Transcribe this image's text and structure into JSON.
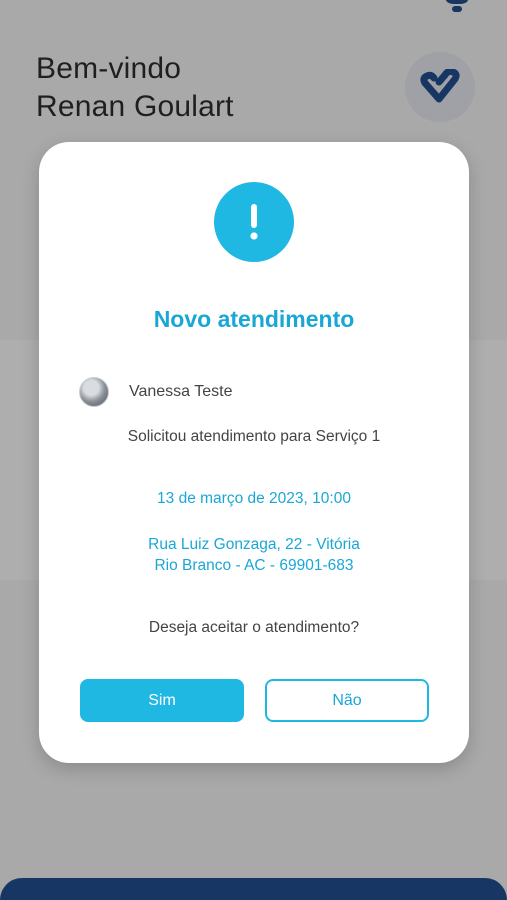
{
  "background": {
    "greeting_line1": "Bem-vindo",
    "greeting_line2": "Renan Goulart",
    "icons": [
      "bell-icon",
      "heart-logo-icon"
    ]
  },
  "modal": {
    "icon": "exclamation-icon",
    "title": "Novo atendimento",
    "user_name": "Vanessa Teste",
    "request": "Solicitou atendimento para Serviço 1",
    "date": "13 de março de 2023, 10:00",
    "address_line1": "Rua Luiz Gonzaga, 22 - Vitória",
    "address_line2": "Rio Branco - AC - 69901-683",
    "question": "Deseja aceitar o atendimento?",
    "accept_label": "Sim",
    "decline_label": "Não"
  },
  "colors": {
    "accent": "#1fb8e2",
    "accent_text": "#1aa7d6",
    "brand_dark": "#0f3f86"
  }
}
